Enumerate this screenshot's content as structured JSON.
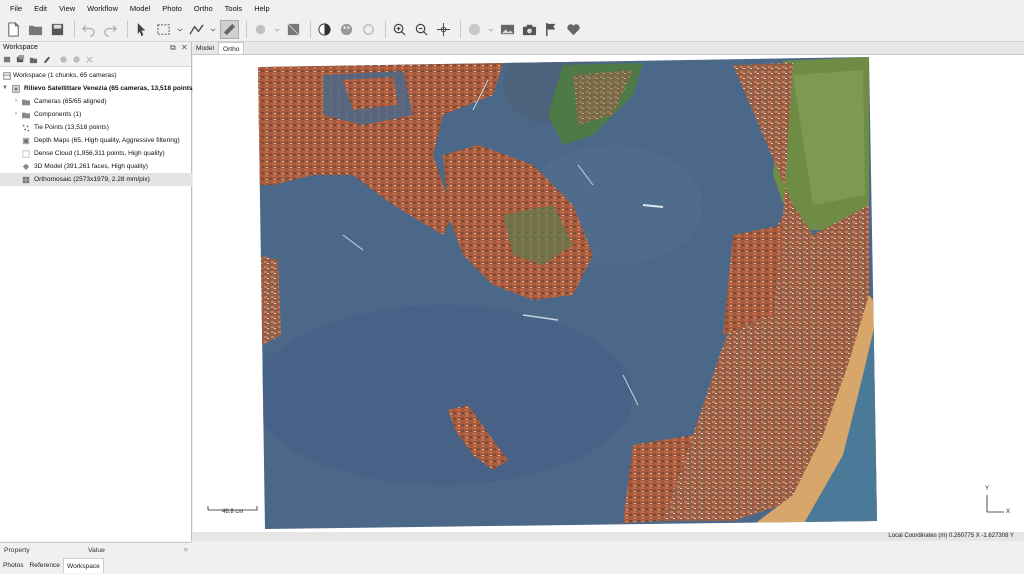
{
  "menu": [
    "File",
    "Edit",
    "View",
    "Workflow",
    "Model",
    "Photo",
    "Ortho",
    "Tools",
    "Help"
  ],
  "workspace_panel": {
    "title": "Workspace",
    "root": "Workspace (1 chunks, 65 cameras)",
    "chunk": "Rilievo Satellittare Venezia (65 cameras, 13,518 points)",
    "items": [
      {
        "label": "Cameras (65/65 aligned)",
        "icon": "folder-icon",
        "expandable": true
      },
      {
        "label": "Components (1)",
        "icon": "folder-icon",
        "expandable": true
      },
      {
        "label": "Tie Points (13,518 points)",
        "icon": "points-icon",
        "expandable": false
      },
      {
        "label": "Depth Maps (65, High quality, Aggressive filtering)",
        "icon": "depth-maps-icon",
        "expandable": false
      },
      {
        "label": "Dense Cloud (1,956,311 points, High quality)",
        "icon": "dense-cloud-icon",
        "expandable": false
      },
      {
        "label": "3D Model (391,261 faces, High quality)",
        "icon": "model-icon",
        "expandable": false
      },
      {
        "label": "Orthomosaic (2573x1979, 2.28 mm/pix)",
        "icon": "orthomosaic-icon",
        "expandable": false,
        "selected": true
      }
    ]
  },
  "property_panel": {
    "col1": "Property",
    "col2": "Value"
  },
  "bottom_tabs": [
    "Photos",
    "Reference",
    "Workspace"
  ],
  "view_tabs": [
    "Model",
    "Ortho"
  ],
  "viewport": {
    "scale_label": "46.8 cm",
    "axis_y": "Y",
    "axis_x": "X"
  },
  "status": "Local Coordinates (m)  0.260775 X  -1.627308 Y",
  "colors": {
    "water": "#4a6688",
    "land": "#a0583c",
    "beach": "#d8a870"
  }
}
